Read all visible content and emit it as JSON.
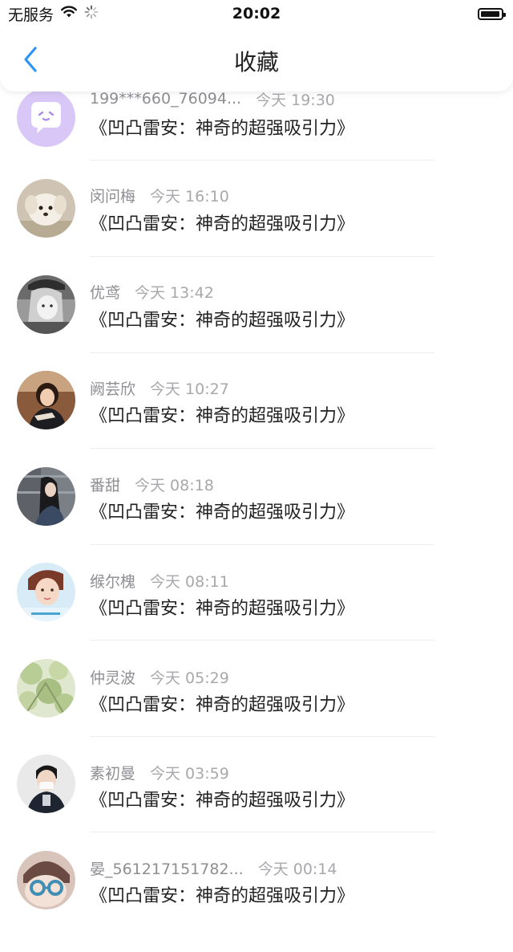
{
  "status_bar": {
    "carrier": "无服务",
    "time": "20:02",
    "wifi_icon": "wifi-icon",
    "loading_icon": "activity-spinner-icon",
    "battery_icon": "battery-icon",
    "battery_level": 0.95
  },
  "nav": {
    "title": "收藏",
    "back_icon": "chevron-left-icon",
    "accent_color": "#2f95f3"
  },
  "items": [
    {
      "name": "199***660_76094...",
      "time": "今天 19:30",
      "title": "《凹凸雷安：神奇的超强吸引力》",
      "avatar_icon": "chat-bubble-avatar"
    },
    {
      "name": "闵问梅",
      "time": "今天 16:10",
      "title": "《凹凸雷安：神奇的超强吸引力》",
      "avatar_icon": "puppy-avatar"
    },
    {
      "name": "优鸢",
      "time": "今天 13:42",
      "title": "《凹凸雷安：神奇的超强吸引力》",
      "avatar_icon": "anime-girl-avatar"
    },
    {
      "name": "阙芸欣",
      "time": "今天 10:27",
      "title": "《凹凸雷安：神奇的超强吸引力》",
      "avatar_icon": "girl-photo-avatar"
    },
    {
      "name": "番甜",
      "time": "今天 08:18",
      "title": "《凹凸雷安：神奇的超强吸引力》",
      "avatar_icon": "girl-long-hair-avatar"
    },
    {
      "name": "缑尔槐",
      "time": "今天 08:11",
      "title": "《凹凸雷安：神奇的超强吸引力》",
      "avatar_icon": "boy-photo-avatar"
    },
    {
      "name": "仲灵波",
      "time": "今天 05:29",
      "title": "《凹凸雷安：神奇的超强吸引力》",
      "avatar_icon": "nature-avatar"
    },
    {
      "name": "素初曼",
      "time": "今天 03:59",
      "title": "《凹凸雷安：神奇的超强吸引力》",
      "avatar_icon": "boy-mask-avatar"
    },
    {
      "name": "晏_561217151782...",
      "time": "今天 00:14",
      "title": "《凹凸雷安：神奇的超强吸引力》",
      "avatar_icon": "cartoon-glasses-avatar"
    }
  ]
}
